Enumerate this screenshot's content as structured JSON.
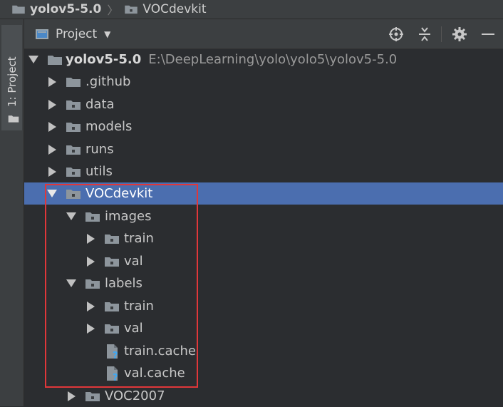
{
  "breadcrumb": {
    "root": "yolov5-5.0",
    "current": "VOCdevkit"
  },
  "sidebar": {
    "tab_label": "1: Project"
  },
  "panel": {
    "title": "Project"
  },
  "tree": {
    "root": {
      "name": "yolov5-5.0",
      "path": "E:\\DeepLearning\\yolo\\yolo5\\yolov5-5.0"
    },
    "items": [
      {
        "label": ".github"
      },
      {
        "label": "data"
      },
      {
        "label": "models"
      },
      {
        "label": "runs"
      },
      {
        "label": "utils"
      },
      {
        "label": "VOCdevkit"
      },
      {
        "label": "images"
      },
      {
        "label": "train"
      },
      {
        "label": "val"
      },
      {
        "label": "labels"
      },
      {
        "label": "train"
      },
      {
        "label": "val"
      },
      {
        "label": "train.cache"
      },
      {
        "label": "val.cache"
      },
      {
        "label": "VOC2007"
      }
    ]
  },
  "colors": {
    "selection": "#4b6eaf",
    "highlight_box": "#e0373a"
  },
  "icons": [
    "folder-icon",
    "target-icon",
    "collapse-icon",
    "gear-icon",
    "minimize-icon",
    "unknown-file-icon"
  ]
}
